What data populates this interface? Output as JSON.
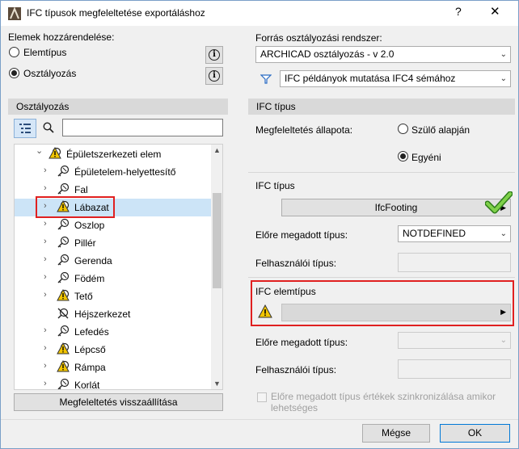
{
  "window": {
    "title": "IFC típusok megfeleltetése exportáláshoz",
    "help": "?",
    "close": "✕"
  },
  "left": {
    "assign_label": "Elemek hozzárendelése:",
    "radio_element_type": "Elemtípus",
    "radio_classification": "Osztályozás",
    "selected_radio": "classification",
    "panel_title": "Osztályozás",
    "search_placeholder": "",
    "tree": [
      {
        "label": "Épületszerkezeti elem",
        "level": 0,
        "expanded": true,
        "icon": "warning-icon"
      },
      {
        "label": "Épületelem-helyettesítő",
        "level": 1,
        "icon": "key-icon"
      },
      {
        "label": "Fal",
        "level": 1,
        "icon": "key-icon"
      },
      {
        "label": "Lábazat",
        "level": 1,
        "icon": "warning-icon",
        "selected": true
      },
      {
        "label": "Oszlop",
        "level": 1,
        "icon": "key-icon"
      },
      {
        "label": "Pillér",
        "level": 1,
        "icon": "key-icon"
      },
      {
        "label": "Gerenda",
        "level": 1,
        "icon": "key-icon"
      },
      {
        "label": "Födém",
        "level": 1,
        "icon": "key-icon"
      },
      {
        "label": "Tető",
        "level": 1,
        "icon": "warning-icon"
      },
      {
        "label": "Héjszerkezet",
        "level": 1,
        "icon": "crossed-icon",
        "no_expander": true
      },
      {
        "label": "Lefedés",
        "level": 1,
        "icon": "key-icon"
      },
      {
        "label": "Lépcső",
        "level": 1,
        "icon": "warning-icon"
      },
      {
        "label": "Rámpa",
        "level": 1,
        "icon": "warning-icon"
      },
      {
        "label": "Korlát",
        "level": 1,
        "icon": "key-icon"
      }
    ],
    "reset_button": "Megfeleltetés visszaállítása"
  },
  "right": {
    "source_label": "Forrás osztályozási rendszer:",
    "source_value": "ARCHICAD osztályozás - v 2.0",
    "filter_value": "IFC példányok mutatása IFC4 sémához",
    "ifc_type_header": "IFC típus",
    "mapping_state_label": "Megfeleltetés állapota:",
    "radio_parent": "Szülő alapján",
    "radio_custom": "Egyéni",
    "ifc_type_label": "IFC típus",
    "ifc_type_value": "IfcFooting",
    "predefined_label_1": "Előre megadott típus:",
    "predefined_value_1": "NOTDEFINED",
    "user_type_label_1": "Felhasználói típus:",
    "ifc_element_type_label": "IFC elemtípus",
    "predefined_label_2": "Előre megadott típus:",
    "user_type_label_2": "Felhasználói típus:",
    "sync_label": "Előre megadott típus értékek szinkronizálása amikor lehetséges"
  },
  "footer": {
    "cancel": "Mégse",
    "ok": "OK"
  },
  "colors": {
    "highlight": "#e02020",
    "selection": "#cce4f7",
    "check": "#5cb82a",
    "warning": "#f2c500"
  }
}
